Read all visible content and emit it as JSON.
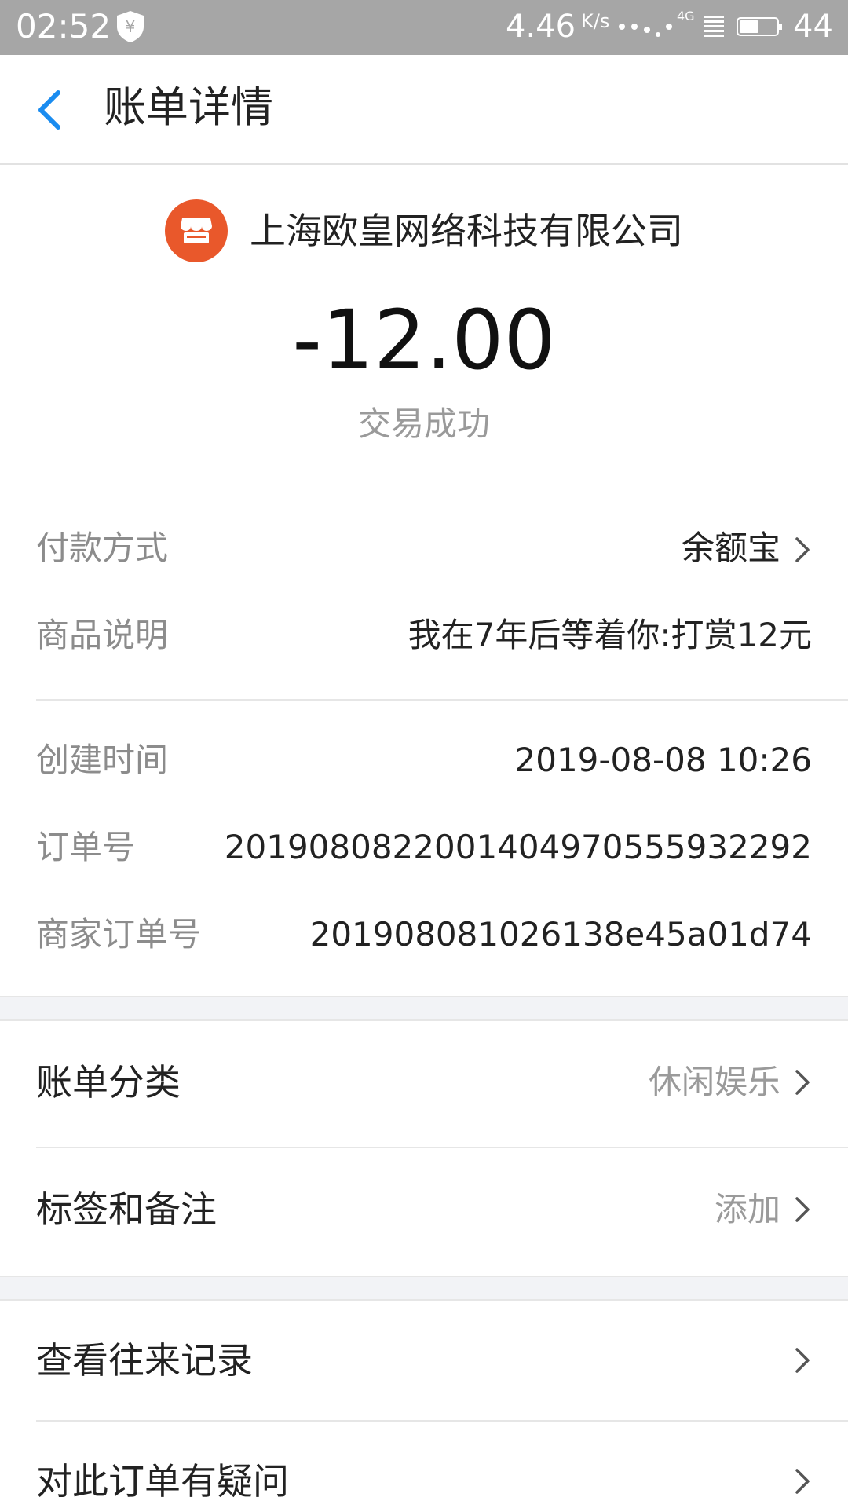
{
  "status_bar": {
    "time": "02:52",
    "speed": "4.46",
    "speed_unit": "K/s",
    "network": "4G",
    "battery": "44",
    "shield_icon": "yuan-shield-icon"
  },
  "header": {
    "title": "账单详情",
    "back_icon": "chevron-left-icon",
    "accent_color": "#1a8cf0"
  },
  "merchant": {
    "name": "上海欧皇网络科技有限公司",
    "logo_icon": "store-icon",
    "logo_color": "#e9582b"
  },
  "amount": "-12.00",
  "status": "交易成功",
  "details": [
    {
      "label": "付款方式",
      "value": "余额宝"
    },
    {
      "label": "商品说明",
      "value": "我在7年后等着你:打赏12元"
    },
    {
      "label": "创建时间",
      "value": "2019-08-08 10:26"
    },
    {
      "label": "订单号",
      "value": "2019080822001404970555932292"
    },
    {
      "label": "商家订单号",
      "value": "201908081026138e45a01d74"
    }
  ],
  "settings": [
    {
      "label": "账单分类",
      "value": "休闲娱乐"
    },
    {
      "label": "标签和备注",
      "value": "添加"
    }
  ],
  "actions": [
    {
      "label": "查看往来记录"
    },
    {
      "label": "对此订单有疑问"
    }
  ]
}
